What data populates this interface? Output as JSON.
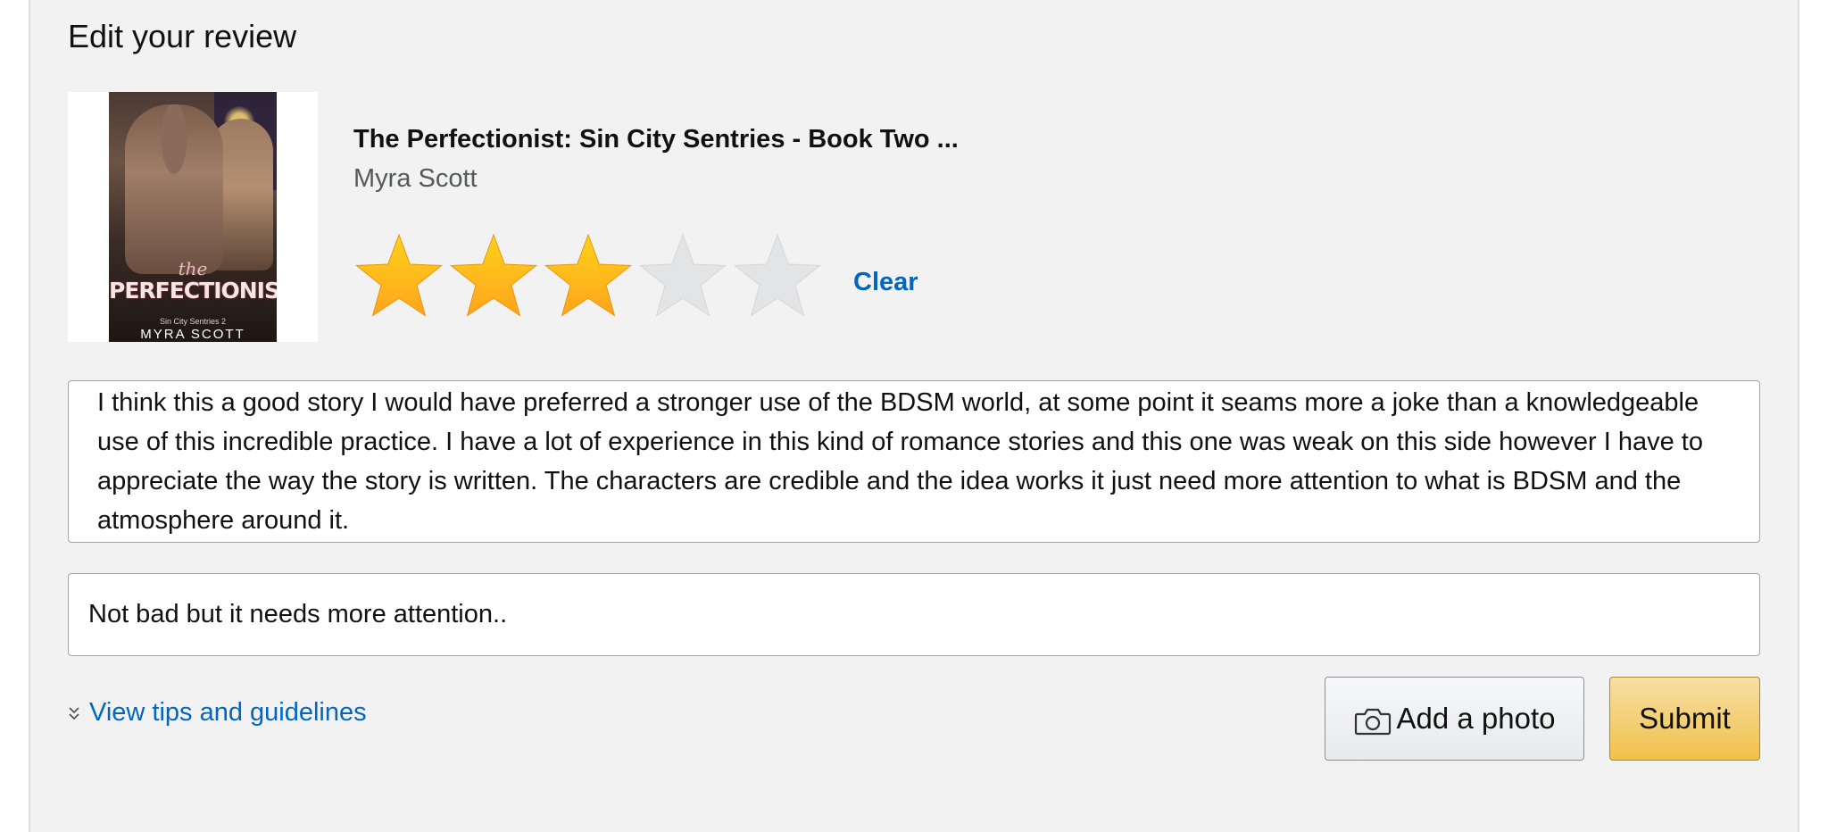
{
  "page": {
    "title": "Edit your review"
  },
  "product": {
    "title": "The Perfectionist: Sin City Sentries - Book Two ...",
    "author": "Myra Scott",
    "cover": {
      "the_text": "the",
      "title_text": "PERFECTIONIST",
      "series_text": "Sin City Sentries 2",
      "author_text": "MYRA SCOTT"
    }
  },
  "rating": {
    "value": 3,
    "max": 5,
    "filled_color": "#ffa41c",
    "empty_color": "#e3e4e6",
    "clear_label": "Clear"
  },
  "review": {
    "body": "I think this a good story I would have preferred a stronger use of the BDSM world, at some point it seams more a joke than a knowledgeable use of this incredible practice. I have a lot of experience in this kind of romance stories and this one was weak on this side however I have to appreciate the way the story is written. The characters are credible and the idea works it just need more attention to what is BDSM and the atmosphere around it.",
    "headline": "Not bad but it needs more attention.."
  },
  "actions": {
    "tips_label": "View tips and guidelines",
    "tips_icon": "double-chevron-down-icon",
    "add_photo_label": "Add a photo",
    "add_photo_icon": "camera-icon",
    "submit_label": "Submit"
  }
}
